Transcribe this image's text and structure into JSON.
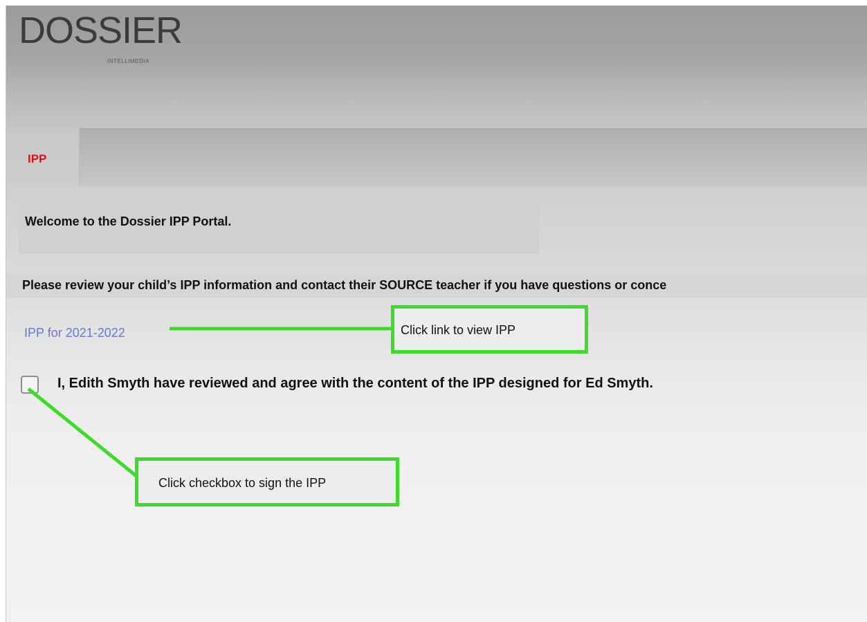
{
  "header": {
    "logo_text": "DOSSIER",
    "logo_subtext": "INTELLIMEDIA"
  },
  "tabs": [
    {
      "label": "IPP",
      "active": true
    }
  ],
  "main": {
    "welcome_text": "Welcome to the Dossier IPP Portal.",
    "review_text": "Please review your child’s IPP information and contact their SOURCE teacher if you have questions or conce",
    "ipp_link_label": "IPP for 2021-2022",
    "agree_checkbox_checked": false,
    "agree_text": "I, Edith Smyth have reviewed and agree with the content of the IPP designed for Ed Smyth."
  },
  "annotations": {
    "link_callout": "Click link to view IPP",
    "checkbox_callout": "Click checkbox to sign the IPP"
  },
  "colors": {
    "tab_label": "#e01010",
    "link": "#6a76d8",
    "callout_border": "#3ddc2a"
  }
}
